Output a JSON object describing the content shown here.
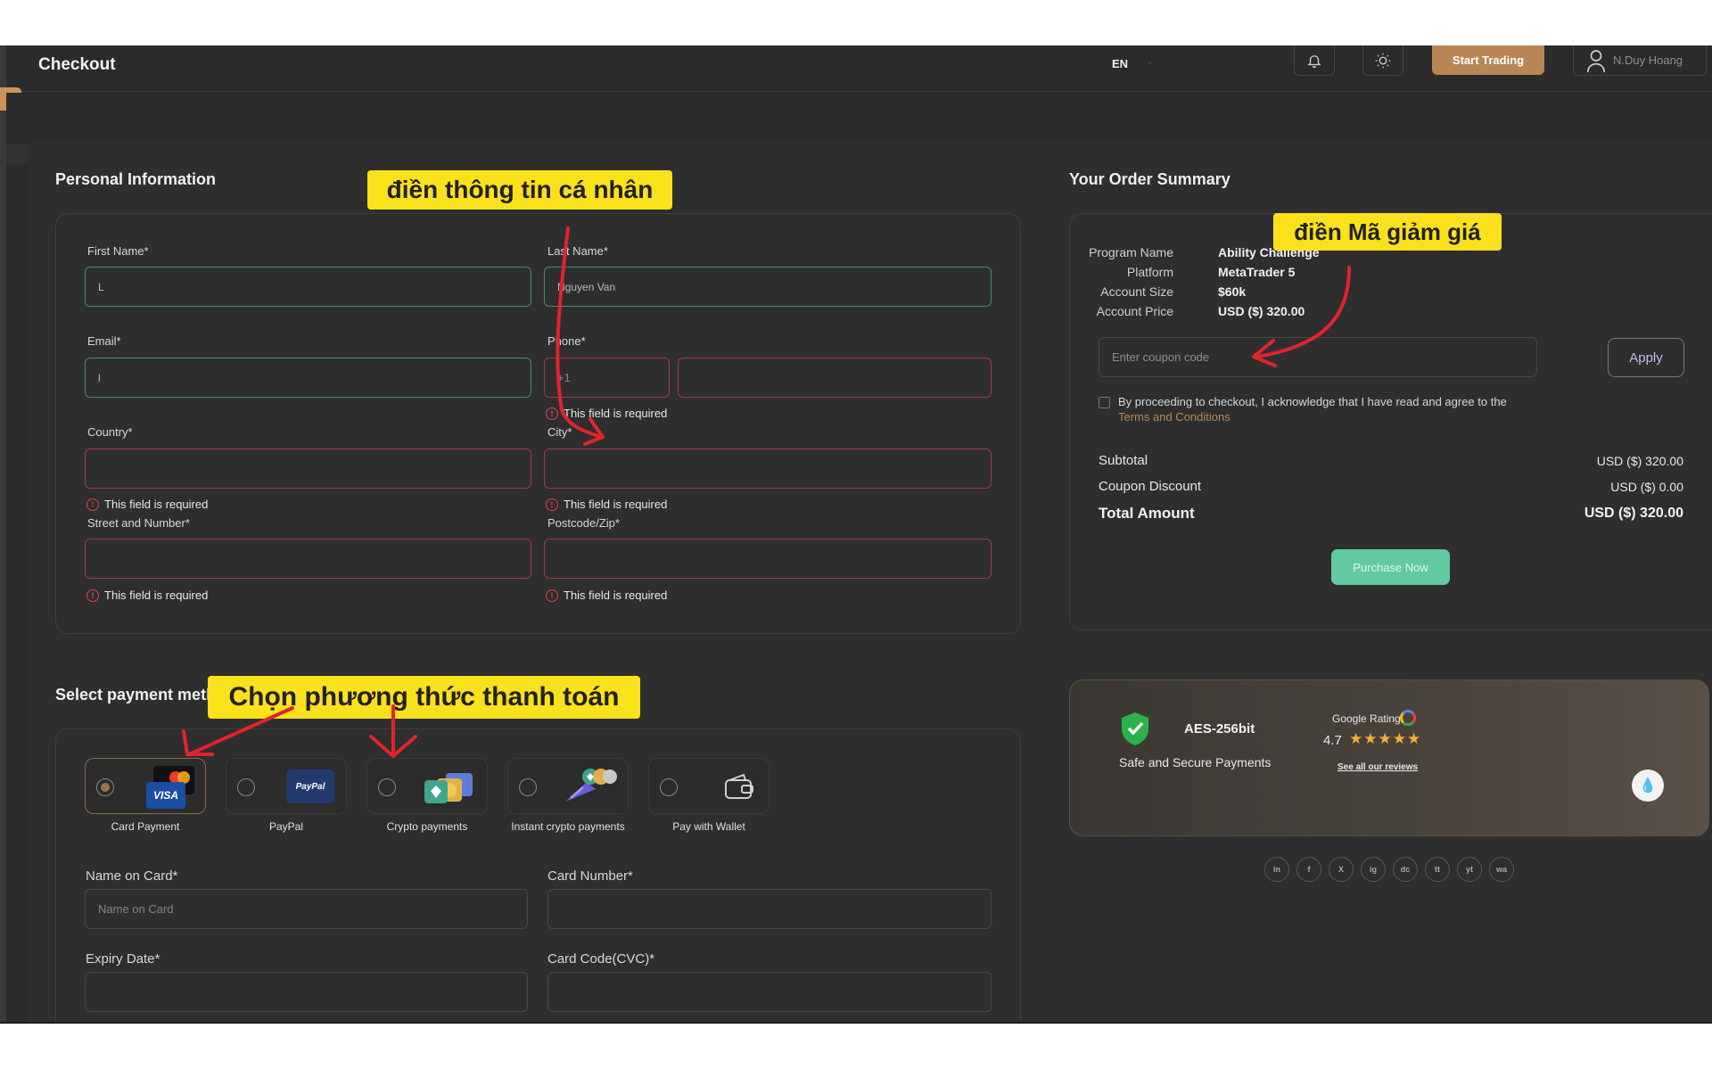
{
  "header": {
    "title": "Checkout",
    "language": "EN",
    "start_trading": "Start Trading",
    "user_name": "N.Duy Hoang"
  },
  "personal": {
    "title": "Personal Information",
    "first_name": {
      "label": "First Name*",
      "value": "L"
    },
    "last_name": {
      "label": "Last Name*",
      "value": "Nguyen Van"
    },
    "email": {
      "label": "Email*",
      "value": "l"
    },
    "phone": {
      "label": "Phone*",
      "code_placeholder": "+1",
      "number_value": ""
    },
    "country": {
      "label": "Country*"
    },
    "city": {
      "label": "City*"
    },
    "street": {
      "label": "Street and Number*"
    },
    "postcode": {
      "label": "Postcode/Zip*"
    },
    "required_error": "This field is required"
  },
  "payment": {
    "title": "Select payment method",
    "methods": [
      {
        "label": "Card Payment",
        "selected": true
      },
      {
        "label": "PayPal",
        "selected": false
      },
      {
        "label": "Crypto payments",
        "selected": false
      },
      {
        "label": "Instant crypto payments",
        "selected": false
      },
      {
        "label": "Pay with Wallet",
        "selected": false
      }
    ],
    "name_on_card": {
      "label": "Name on Card*",
      "placeholder": "Name on Card"
    },
    "card_number": {
      "label": "Card Number*"
    },
    "expiry": {
      "label": "Expiry Date*"
    },
    "cvc": {
      "label": "Card Code(CVC)*"
    },
    "visa_text": "VISA",
    "paypal_text": "PayPal"
  },
  "order": {
    "title": "Your Order Summary",
    "program_name_key": "Program Name",
    "program_name": "Ability Challenge",
    "platform_key": "Platform",
    "platform": "MetaTrader 5",
    "account_size_key": "Account Size",
    "account_size": "$60k",
    "account_price_key": "Account Price",
    "account_price": "USD ($) 320.00",
    "coupon_placeholder": "Enter coupon code",
    "apply": "Apply",
    "agree_text": "By proceeding to checkout, I acknowledge that I have read and agree to the",
    "terms": "Terms and Conditions",
    "subtotal_label": "Subtotal",
    "subtotal": "USD ($) 320.00",
    "discount_label": "Coupon Discount",
    "discount": "USD ($) 0.00",
    "total_label": "Total Amount",
    "total": "USD ($) 320.00",
    "purchase": "Purchase Now"
  },
  "security": {
    "aes": "AES-256bit",
    "safe": "Safe and Secure Payments",
    "google_rating_label": "Google Rating",
    "rating": "4.7",
    "reviews_link": "See all our reviews"
  },
  "social": [
    "in",
    "f",
    "X",
    "ig",
    "dc",
    "tt",
    "yt",
    "wa"
  ],
  "annotations": {
    "personal": "điền thông tin cá nhân",
    "coupon": "điền Mã giảm giá",
    "payment": "Chọn phương thức thanh toán"
  },
  "colors": {
    "accent": "#b88656",
    "success": "#63c9a0",
    "error": "#e0454f",
    "annotation": "#fbe11c",
    "arrow": "#e0242c"
  }
}
